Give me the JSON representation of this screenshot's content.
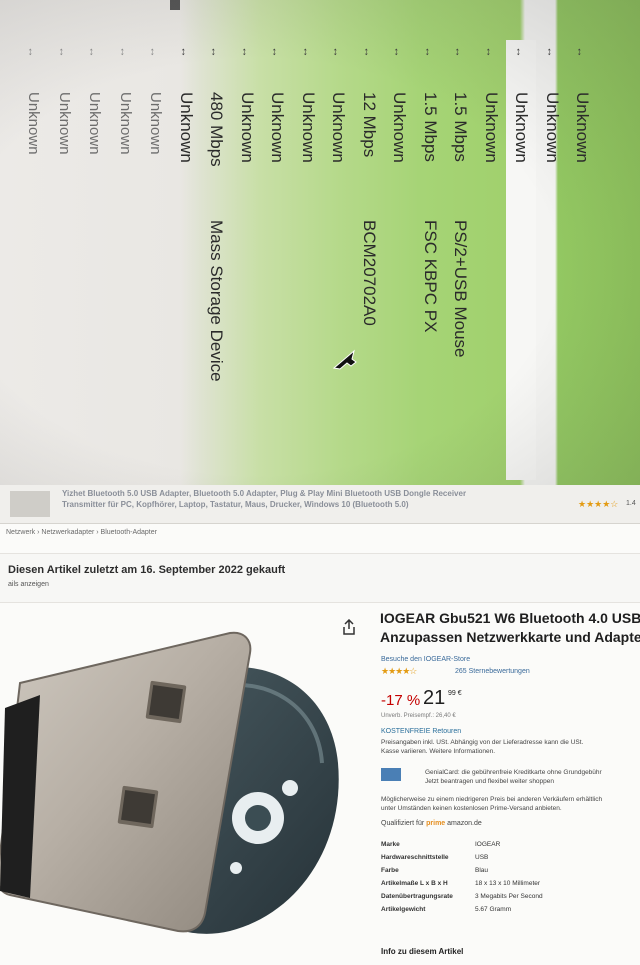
{
  "top_screen": {
    "rows": [
      {
        "speed": "Unknown",
        "description": "",
        "style": "faint"
      },
      {
        "speed": "Unknown",
        "description": "",
        "style": "faint"
      },
      {
        "speed": "Unknown",
        "description": "",
        "style": "faint"
      },
      {
        "speed": "Unknown",
        "description": "",
        "style": "faint"
      },
      {
        "speed": "Unknown",
        "description": "",
        "style": "faint"
      },
      {
        "speed": "Unknown",
        "description": "",
        "style": "normal"
      },
      {
        "speed": "480 Mbps",
        "description": "Mass Storage Device",
        "style": "normal"
      },
      {
        "speed": "Unknown",
        "description": "",
        "style": "normal"
      },
      {
        "speed": "Unknown",
        "description": "",
        "style": "normal"
      },
      {
        "speed": "Unknown",
        "description": "",
        "style": "normal"
      },
      {
        "speed": "Unknown",
        "description": "",
        "style": "normal"
      },
      {
        "speed": "12 Mbps",
        "description": "BCM20702A0",
        "style": "normal"
      },
      {
        "speed": "Unknown",
        "description": "",
        "style": "normal"
      },
      {
        "speed": "1.5 Mbps",
        "description": "FSC KBPC PX",
        "style": "normal"
      },
      {
        "speed": "1.5 Mbps",
        "description": "PS/2+USB Mouse",
        "style": "normal"
      },
      {
        "speed": "Unknown",
        "description": "",
        "style": "normal"
      },
      {
        "speed": "Unknown",
        "description": "",
        "style": "selected"
      },
      {
        "speed": "Unknown",
        "description": "",
        "style": "normal"
      },
      {
        "speed": "Unknown",
        "description": "",
        "style": "normal"
      }
    ],
    "arrow_glyph": "↔"
  },
  "amazon": {
    "sticky_title_line1": "Yizhet Bluetooth 5.0 USB Adapter, Bluetooth 5.0 Adapter, Plug & Play Mini Bluetooth USB Dongle Receiver",
    "sticky_title_line2": "Transmitter für PC, Kopfhörer, Laptop, Tastatur, Maus, Drucker, Windows 10 (Bluetooth 5.0)",
    "sticky_stars": "★★★★☆",
    "sticky_count": "1.4",
    "breadcrumb": "Netzwerk › Netzwerkadapter › Bluetooth-Adapter",
    "purchase_notice": "Diesen Artikel zuletzt am 16. September 2022 gekauft",
    "purchase_link": "ails anzeigen",
    "title_line1": "IOGEAR Gbu521 W6 Bluetooth 4.0 USB",
    "title_line2": "Anzupassen Netzwerkkarte und Adapter",
    "store_link": "Besuche den IOGEAR-Store",
    "rating_stars": "★★★★☆",
    "rating_count": "265 Sternebewertungen",
    "discount": "-17 %",
    "price": "21",
    "price_cents": "99 €",
    "uvp": "Unverb. Preisempf.: 26,40 €",
    "free_returns": "KOSTENFREIE Retouren",
    "tax_line1": "Preisangaben inkl. USt. Abhängig von der Lieferadresse kann die USt.",
    "tax_line2": "Kasse variieren. Weitere Informationen.",
    "gcard_line1": "GenialCard: die gebührenfreie Kreditkarte ohne Grundgebühr",
    "gcard_line2": "Jetzt beantragen und flexibel weiter shoppen",
    "cheaper_line1": "Möglicherweise zu einem niedrigeren Preis bei anderen Verkäufern erhältlich",
    "cheaper_line2": "unter Umständen keinen kostenlosen Prime-Versand anbieten.",
    "prime_prefix": "Qualifiziert für",
    "prime_label": "prime",
    "prime_suffix": "amazon.de",
    "specs": [
      {
        "key": "Marke",
        "value": "IOGEAR"
      },
      {
        "key": "Hardwareschnittstelle",
        "value": "USB"
      },
      {
        "key": "Farbe",
        "value": "Blau"
      },
      {
        "key": "Artikelmaße L x B x H",
        "value": "18 x 13 x 10 Millimeter"
      },
      {
        "key": "Datenübertragungsrate",
        "value": "3 Megabits Per Second"
      },
      {
        "key": "Artikelgewicht",
        "value": "5.67 Gramm"
      }
    ],
    "info_heading": "Info zu diesem Artikel"
  }
}
